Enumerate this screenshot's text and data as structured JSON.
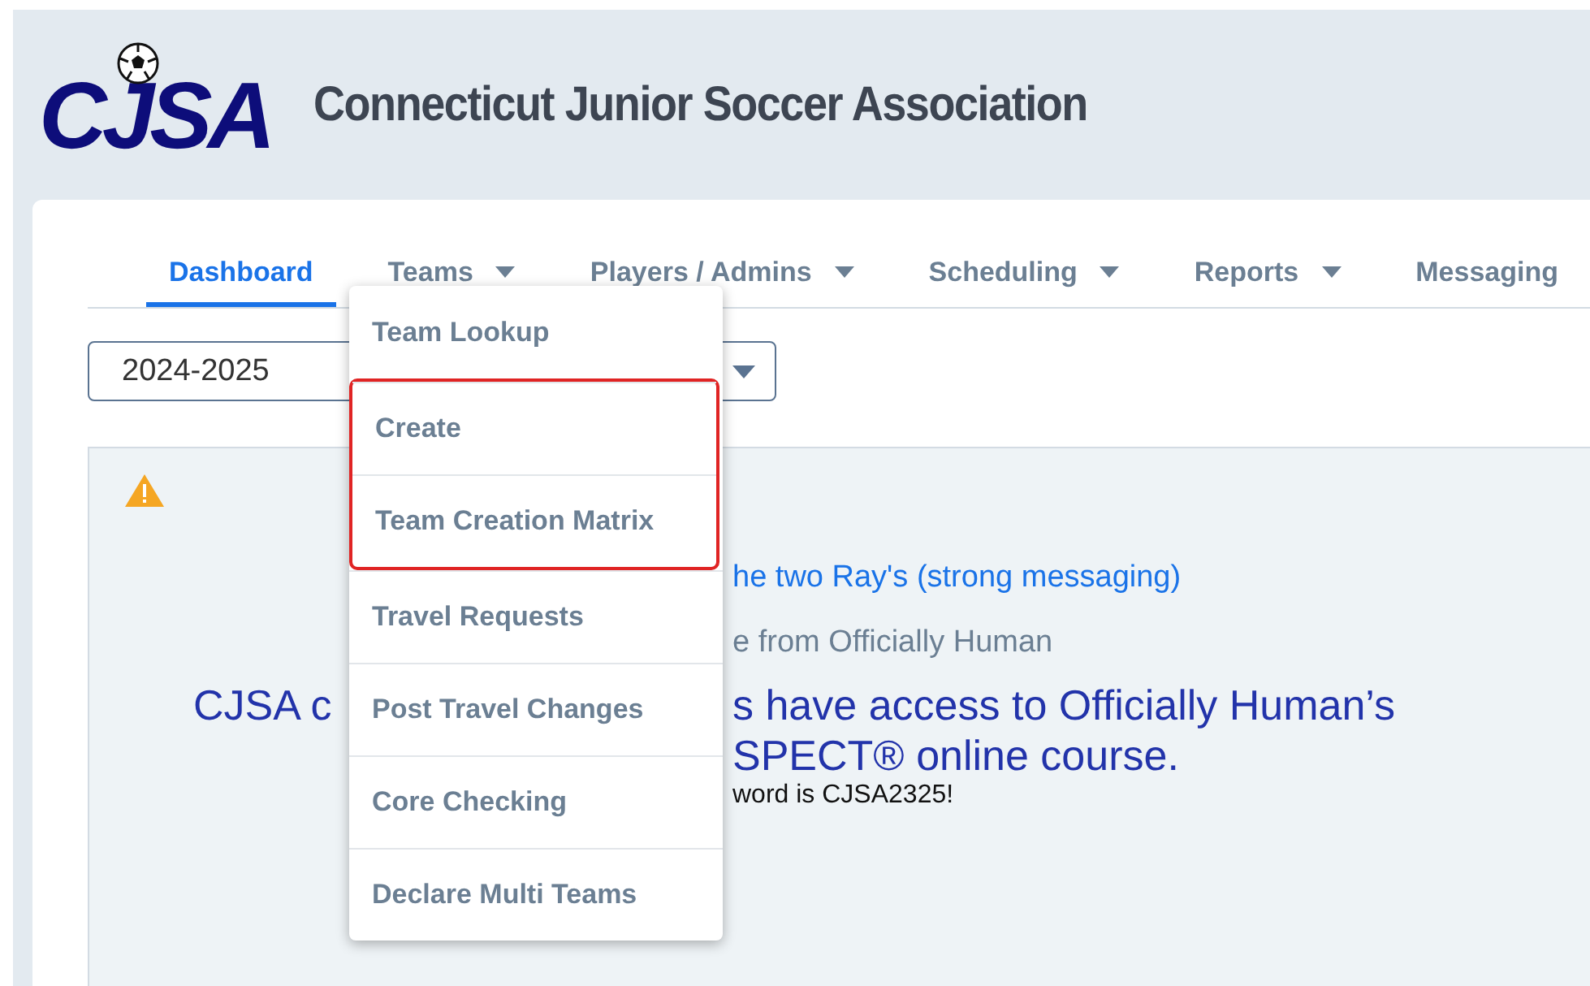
{
  "header": {
    "logo": "CJSA",
    "title": "Connecticut Junior Soccer Association"
  },
  "nav": [
    {
      "label": "Dashboard",
      "selected": true,
      "has_menu": false
    },
    {
      "label": "Teams",
      "selected": false,
      "has_menu": true
    },
    {
      "label": "Players / Admins",
      "selected": false,
      "has_menu": true
    },
    {
      "label": "Scheduling",
      "selected": false,
      "has_menu": true
    },
    {
      "label": "Reports",
      "selected": false,
      "has_menu": true
    },
    {
      "label": "Messaging",
      "selected": false,
      "has_menu": false
    }
  ],
  "season_select": {
    "value": "2024-2025"
  },
  "dropdown": [
    {
      "label": "Team Lookup",
      "highlighted": false
    },
    {
      "label": "Create",
      "highlighted": true
    },
    {
      "label": "Team Creation Matrix",
      "highlighted": true
    },
    {
      "label": "Travel Requests",
      "highlighted": false
    },
    {
      "label": "Post Travel Changes",
      "highlighted": false
    },
    {
      "label": "Core Checking",
      "highlighted": false
    },
    {
      "label": "Declare Multi Teams",
      "highlighted": false
    }
  ],
  "notice": {
    "link": "he two Ray's (strong messaging)",
    "subtitle": "e from Officially Human",
    "headline_left": "CJSA c",
    "headline_right": "s have access to Officially Human’s",
    "headline_line2": "SPECT® online course.",
    "password_note": "word is CJSA2325!"
  }
}
